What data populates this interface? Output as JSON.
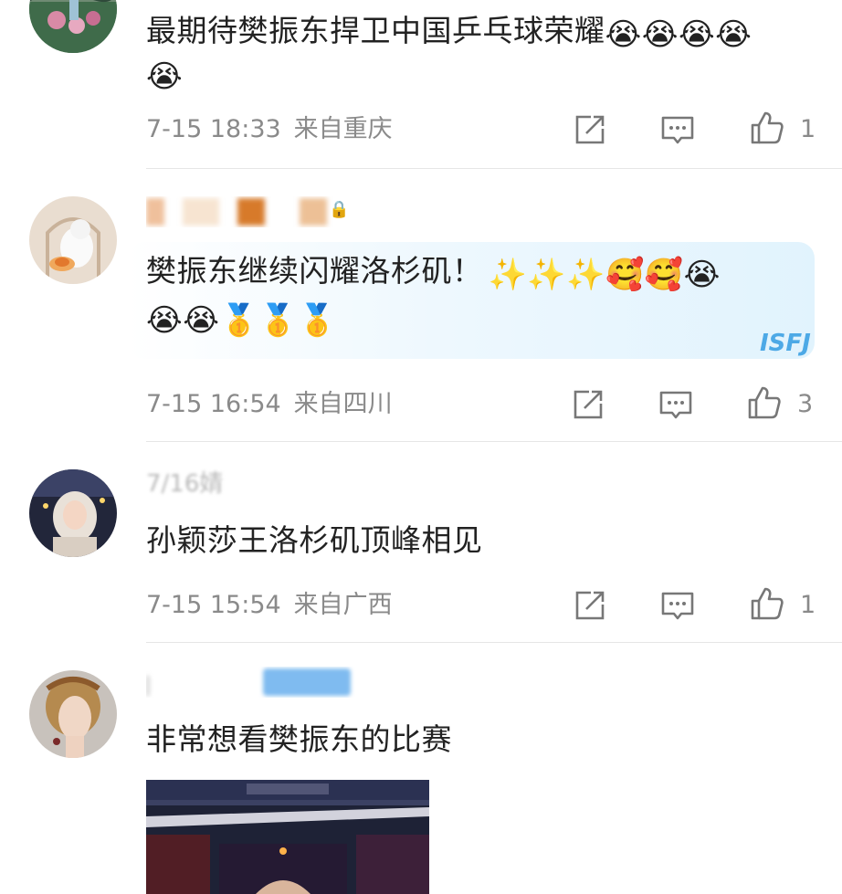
{
  "comments": [
    {
      "text": "最期待樊振东捍卫中国乒乓球荣耀",
      "emojis_line1": "😭😭😭😭",
      "emojis_line2": "😭",
      "time": "7-15 18:33",
      "location": "来自重庆",
      "likes": "1"
    },
    {
      "badge": "🔒",
      "text": "樊振东继续闪耀洛杉矶！",
      "emojis_line1": "✨✨✨🥰🥰😭",
      "emojis_line2": "😭😭🥇🥇🥇",
      "bubble_tag": "ISFJ",
      "time": "7-15 16:54",
      "location": "来自四川",
      "likes": "3"
    },
    {
      "username": "7/16婧",
      "text": "孙颖莎王洛杉矶顶峰相见",
      "time": "7-15 15:54",
      "location": "来自广西",
      "likes": "1"
    },
    {
      "text": "非常想看樊振东的比赛"
    }
  ],
  "icons": {
    "share": "share-icon",
    "reply": "comment-icon",
    "like": "thumbs-up-icon"
  },
  "colors": {
    "meta_text": "#8a8a8a",
    "bubble_accent": "#4da9e6",
    "divider": "#e6e6e6"
  }
}
